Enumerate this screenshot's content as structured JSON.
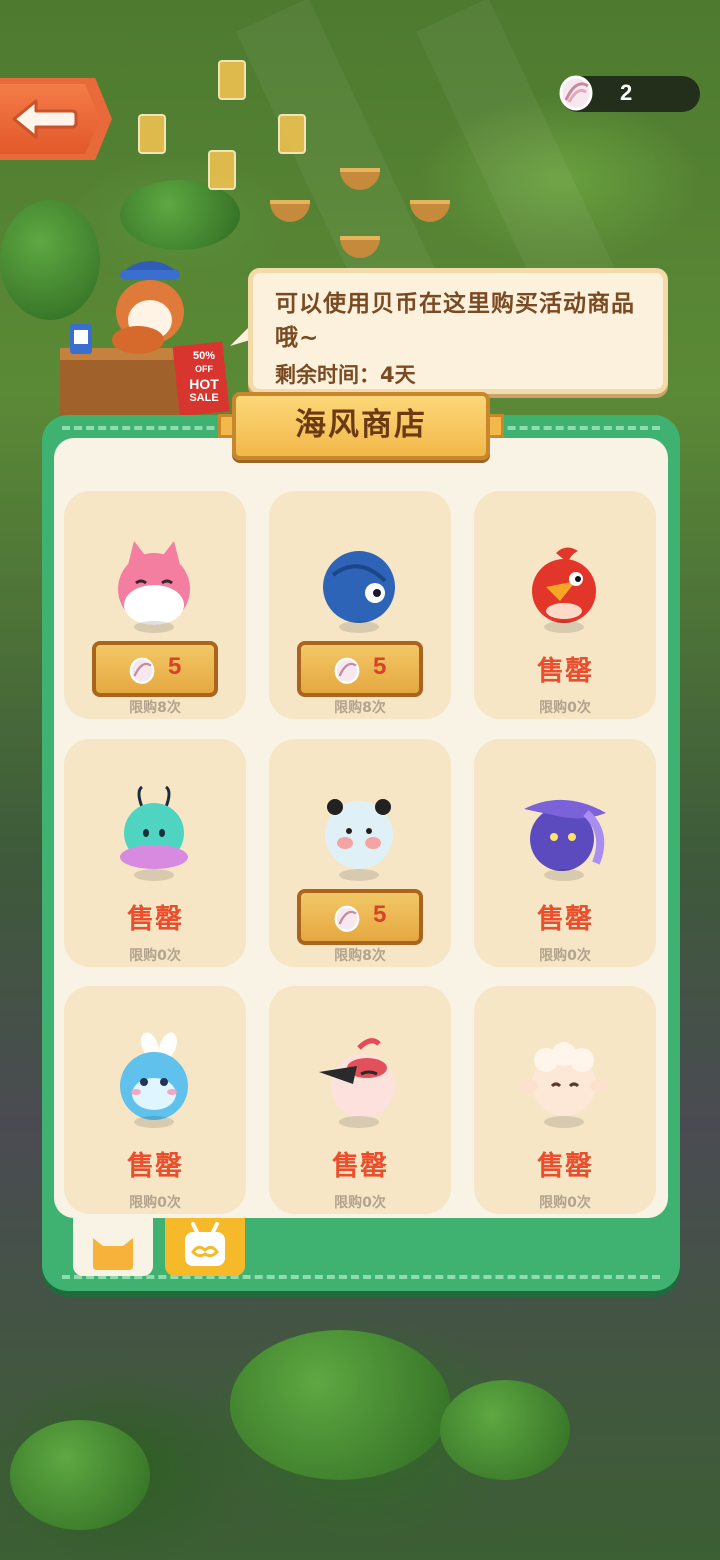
{
  "currency": {
    "icon": "shell-icon",
    "count": "2"
  },
  "back": {
    "icon": "back-arrow-icon"
  },
  "shopkeeper": {
    "sign": [
      "50%",
      "OFF",
      "HOT",
      "SALE"
    ]
  },
  "bubble": {
    "message": "可以使用贝币在这里购买活动商品哦~",
    "time_label": "剩余时间：4天"
  },
  "shop": {
    "title": "海风商店"
  },
  "items": [
    {
      "name": "pink-fox-character",
      "status": "price",
      "price": "5",
      "limit": "限购8次"
    },
    {
      "name": "blue-whale-character",
      "status": "price",
      "price": "5",
      "limit": "限购8次"
    },
    {
      "name": "red-bird-character",
      "status": "sold",
      "sold_label": "售罄",
      "limit": "限购0次"
    },
    {
      "name": "teal-jellyfish-character",
      "status": "sold",
      "sold_label": "售罄",
      "limit": "限购0次"
    },
    {
      "name": "panda-character",
      "status": "price",
      "price": "5",
      "limit": "限购8次"
    },
    {
      "name": "purple-witch-character",
      "status": "sold",
      "sold_label": "售罄",
      "limit": "限购0次"
    },
    {
      "name": "white-bunny-character",
      "status": "sold",
      "sold_label": "售罄",
      "limit": "限购0次"
    },
    {
      "name": "pink-toucan-character",
      "status": "sold",
      "sold_label": "售罄",
      "limit": "限购0次"
    },
    {
      "name": "sheep-character",
      "status": "sold",
      "sold_label": "售罄",
      "limit": "限购0次"
    }
  ],
  "tabs": [
    {
      "icon": "cat-icon",
      "active": true
    },
    {
      "icon": "tv-icon",
      "active": false
    }
  ],
  "colors": {
    "panel": "#3fb271",
    "soldout": "#ea4f2d",
    "price": "#d9412b",
    "card": "#f6e6c6"
  }
}
